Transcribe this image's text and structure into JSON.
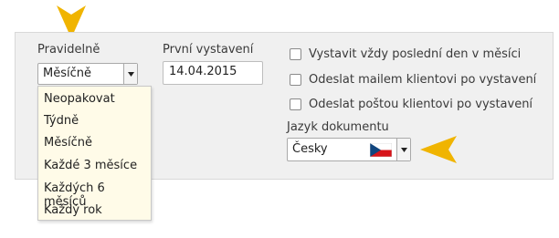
{
  "colors": {
    "accent_arrow": "#f0b400",
    "dropdown_bg": "#fffbe8",
    "panel_bg": "#f0f0f0"
  },
  "frequency": {
    "label": "Pravidelně",
    "selected": "Měsíčně",
    "options": [
      "Neopakovat",
      "Týdně",
      "Měsíčně",
      "Každé 3 měsíce",
      "Každých 6 měsíců",
      "Každý rok"
    ]
  },
  "first_issue": {
    "label": "První vystavení",
    "value": "14.04.2015"
  },
  "checkboxes": [
    {
      "label": "Vystavit vždy poslední den v měsíci",
      "checked": false
    },
    {
      "label": "Odeslat mailem klientovi po vystavení",
      "checked": false
    },
    {
      "label": "Odeslat poštou klientovi po vystavení",
      "checked": false
    }
  ],
  "language": {
    "label": "Jazyk dokumentu",
    "selected": "Česky",
    "flag_icon": "czech-flag-icon"
  },
  "icons": {
    "dropdown": "triangle-down-icon",
    "pointer": "pointer-arrow-icon"
  }
}
